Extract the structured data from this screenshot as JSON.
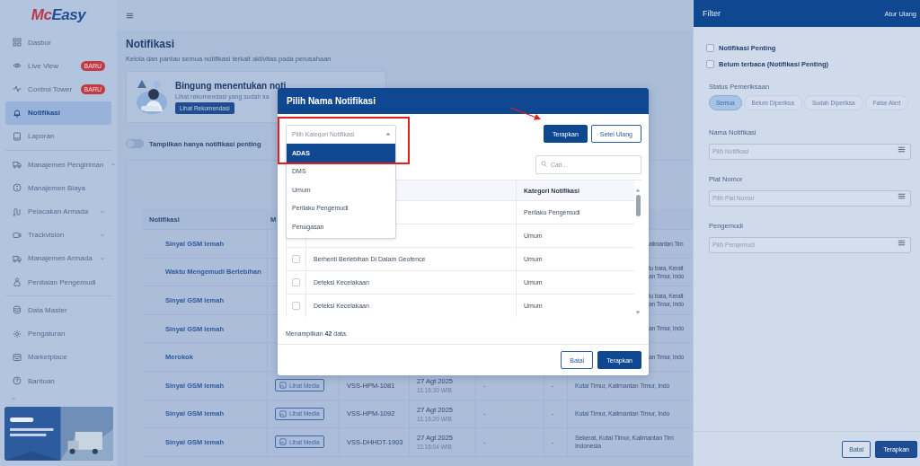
{
  "sidebar": {
    "logo": [
      "Mc",
      "Easy"
    ],
    "groups": [
      [
        {
          "label": "Dasbor",
          "selected": false,
          "expandable": false
        },
        {
          "label": "Live View",
          "selected": false,
          "expandable": false,
          "badge": "BARU"
        },
        {
          "label": "Control Tower",
          "selected": false,
          "expandable": false,
          "badge": "BARU"
        },
        {
          "label": "Notifikasi",
          "selected": true,
          "expandable": false
        },
        {
          "label": "Laporan",
          "selected": false,
          "expandable": false
        }
      ],
      [
        {
          "label": "Manajemen Pengiriman",
          "selected": false,
          "expandable": true
        },
        {
          "label": "Manajemen Biaya",
          "selected": false,
          "expandable": false
        },
        {
          "label": "Pelacakan Armada",
          "selected": false,
          "expandable": true
        },
        {
          "label": "Trackvision",
          "selected": false,
          "expandable": true
        },
        {
          "label": "Manajemen Armada",
          "selected": false,
          "expandable": true
        },
        {
          "label": "Penilaian Pengemudi",
          "selected": false,
          "expandable": false
        }
      ],
      [
        {
          "label": "Data Master",
          "selected": false,
          "expandable": false
        },
        {
          "label": "Pengaturan",
          "selected": false,
          "expandable": false
        },
        {
          "label": "Marketplace",
          "selected": false,
          "expandable": false
        },
        {
          "label": "Bantuan",
          "selected": false,
          "expandable": false
        }
      ]
    ],
    "promo": {
      "kind": "picture"
    }
  },
  "page": {
    "title": "Notifikasi",
    "subtitle": "Kelola dan pantau semua notifikasi terkait aktivitas pada perusahaan"
  },
  "recommendation": {
    "title": "Bingung menentukan noti",
    "text": "Lihat rekomendasi yang sudah ka",
    "button": "Lihat Rekomendasi"
  },
  "important_toggle": {
    "label": "Tampilkan hanya notifikasi penting",
    "on": false
  },
  "table": {
    "columns": [
      "Notifikasi",
      "M"
    ],
    "rows": [
      {
        "name": "Sinyal GSM lemah",
        "location": [
          "alimantan Tim"
        ]
      },
      {
        "name": "Waktu Mengemudi Berlebihan",
        "location": [
          "tu bara, Kerait",
          "an Timur, Indo"
        ]
      },
      {
        "name": "Sinyal GSM lemah",
        "location": [
          "tu bara, Kerait",
          "an Timur, Indo"
        ]
      },
      {
        "name": "Sinyal GSM lemah",
        "location": [
          "an Timur, Indo"
        ]
      },
      {
        "name": "Merokok",
        "location": [
          "an Timur, Indo"
        ]
      },
      {
        "name": "Sinyal GSM lemah",
        "media": "Lihat Media",
        "plate": "VSS-HPM-1081",
        "date": "27 Agt 2025",
        "time": "11:16:30 WIB",
        "column_5": "-",
        "column_6": "-",
        "location": [
          "Kutai Timur, Kalimantan Timur, Indo"
        ]
      },
      {
        "name": "Sinyal GSM lemah",
        "media": "Lihat Media",
        "plate": "VSS-HPM-1092",
        "date": "27 Agt 2025",
        "time": "11:16:20 WIB",
        "column_5": "-",
        "column_6": "-",
        "location": [
          "Kutai Timur, Kalimantan Timur, Indo"
        ]
      },
      {
        "name": "Sinyal GSM lemah",
        "media": "Lihat Media",
        "plate": "VSS-DHHDT-1903",
        "date": "27 Agt 2025",
        "time": "11:16:04 WIB",
        "column_5": "-",
        "column_6": "-",
        "location": [
          "Sekerat, Kutai Timur, Kalimantan Tim",
          "Indonesia"
        ]
      }
    ]
  },
  "modal": {
    "title": "Pilih Nama Notifikasi",
    "category_select": {
      "placeholder": "Pilih Kategori Notifikasi",
      "expanded": true,
      "options": [
        {
          "label": "ADAS",
          "selected": true
        },
        {
          "label": "DMS",
          "selected": false
        },
        {
          "label": "Umum",
          "selected": false
        },
        {
          "label": "Perilaku Pengemudi",
          "selected": false
        },
        {
          "label": "Penugasan",
          "selected": false
        }
      ]
    },
    "apply_button": "Terapkan",
    "reset_button": "Setel Ulang",
    "search": {
      "placeholder": "Cari..."
    },
    "table": {
      "columns": [
        "Kategori Notifikasi"
      ],
      "rows": [
        {
          "category": "Perilaku Pengemudi"
        },
        {
          "category": "Umum"
        },
        {
          "name": "Berhenti Berlebihan Di Dalam Geofence",
          "category": "Umum",
          "checked": false
        },
        {
          "name": "Deteksi Kecelakaan",
          "category": "Umum",
          "checked": false
        },
        {
          "name": "Deteksi Kecelakaan",
          "category": "Umum",
          "checked": false
        }
      ]
    },
    "footer_text": "Menampilkan **42** data.",
    "cancel_button": "Batal",
    "confirm_button": "Terapkan"
  },
  "filter": {
    "title": "Filter",
    "reset_link": "Atur Ulang",
    "checkboxes": [
      {
        "label": "Notifikasi Penting",
        "checked": false
      },
      {
        "label": "Belum terbaca (Notifikasi Penting)",
        "checked": false
      }
    ],
    "status_label": "Status Pemeriksaan",
    "status_options": [
      {
        "label": "Semua",
        "selected": true
      },
      {
        "label": "Belum Diperiksa",
        "selected": false
      },
      {
        "label": "Sudah Diperiksa",
        "selected": false
      },
      {
        "label": "False Alert",
        "selected": false
      }
    ],
    "fields": [
      {
        "label": "Nama Notifikasi",
        "placeholder": "Pilih Notifikasi"
      },
      {
        "label": "Plat Nomor",
        "placeholder": "Pilih Plat Nomor"
      },
      {
        "label": "Pengemudi",
        "placeholder": "Pilih Pengemudi"
      }
    ],
    "cancel_button": "Batal",
    "apply_button": "Terapkan"
  }
}
